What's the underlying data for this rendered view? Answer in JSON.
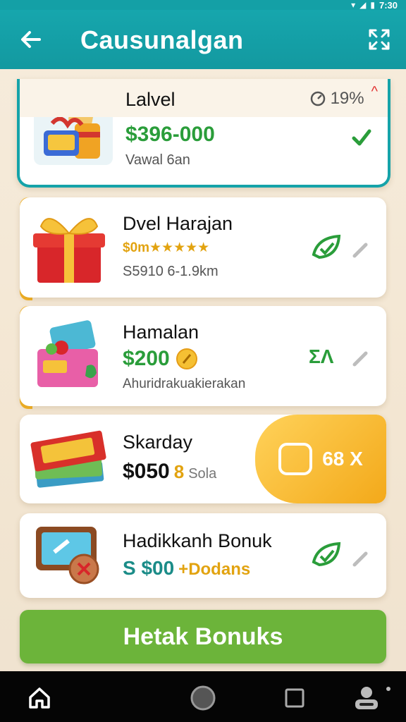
{
  "status_bar": {
    "time": "7:30",
    "battery_icon": "battery-icon",
    "signal_icon": "signal-icon"
  },
  "app_bar": {
    "title": "Causunalgan",
    "back_icon": "back-arrow-icon",
    "expand_icon": "expand-icon"
  },
  "cards": [
    {
      "name": "Lalvel",
      "amount": "$396-000",
      "sub": "Vawal 6an",
      "percent": "19%",
      "amount_color": "#2a9d3a"
    },
    {
      "name": "Dvel Harajan",
      "rating_text": "$0m★★★★★",
      "sub": "S5910 6-1.9km"
    },
    {
      "name": "Hamalan",
      "amount": "$200",
      "sub": "Ahuridrakuakierakan",
      "side_label": "ΣΛ"
    },
    {
      "name": "Skarday",
      "amount": "$050",
      "amount_extra": "8",
      "amount_extra_label": "Sola",
      "promo_label": "68 X"
    },
    {
      "name": "Hadikkanh Bonuk",
      "amount": "S $00",
      "amount_suffix": "+Dodans"
    }
  ],
  "cta": {
    "label": "Hetak Bonuks"
  },
  "colors": {
    "teal": "#15a3a9",
    "green": "#2a9d3a",
    "orange": "#f3a91a",
    "cta_green": "#6cb43a"
  }
}
